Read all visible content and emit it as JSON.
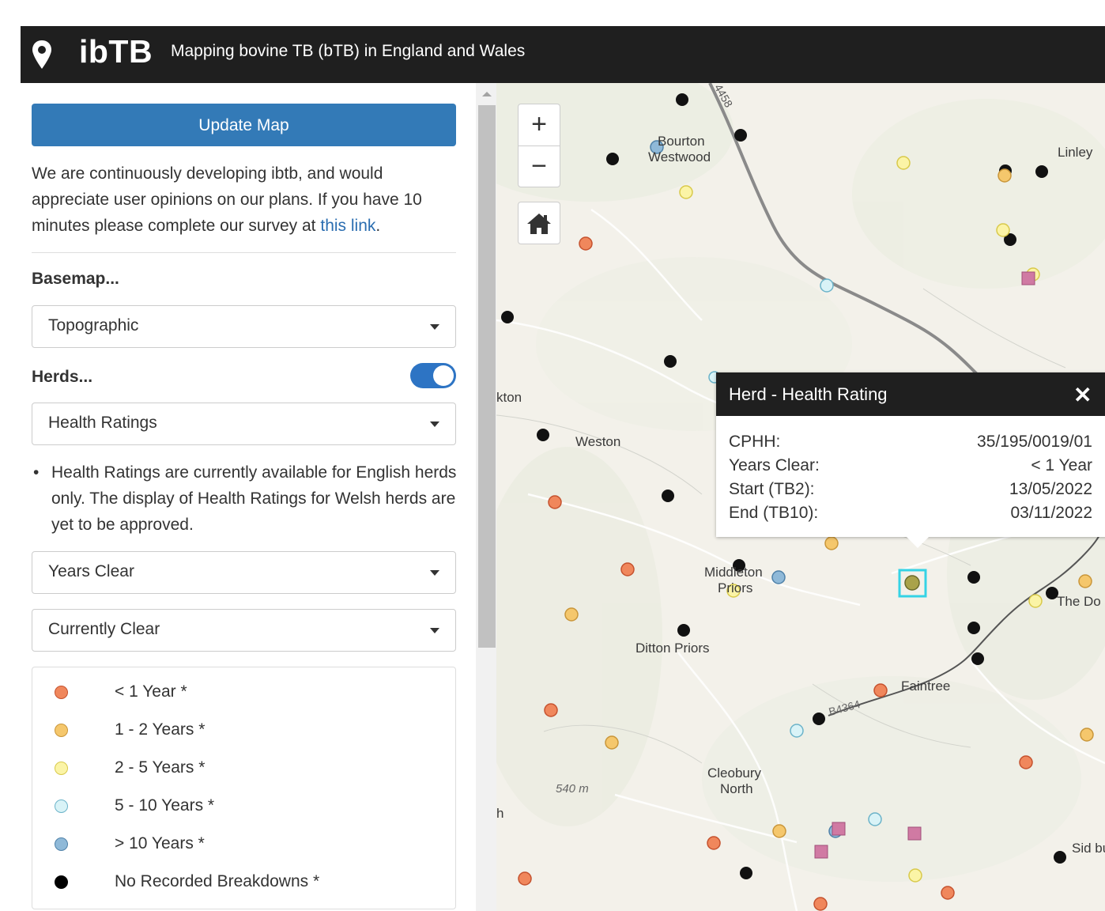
{
  "header": {
    "logo": "ibTB",
    "subtitle": "Mapping bovine TB (bTB) in England and Wales"
  },
  "sidebar": {
    "update_button": "Update Map",
    "intro_text": "We are continuously developing ibtb, and would appreciate user opinions on our plans. If you have 10 minutes please complete our survey at ",
    "intro_link": "this link",
    "intro_end": ".",
    "basemap_label": "Basemap...",
    "basemap_value": "Topographic",
    "herds_label": "Herds...",
    "herds_toggle_on": true,
    "herds_value": "Health Ratings",
    "note_bullet": "•",
    "note_text": "Health Ratings are currently available for English herds only. The display of Health Ratings for Welsh herds are yet to be approved.",
    "years_clear_value": "Years Clear",
    "currently_clear_value": "Currently Clear",
    "legend": [
      {
        "label": "< 1 Year *",
        "color": "#f0875c"
      },
      {
        "label": "1 - 2 Years *",
        "color": "#f5c76c"
      },
      {
        "label": "2 - 5 Years *",
        "color": "#fbf4a6"
      },
      {
        "label": "5 - 10 Years *",
        "color": "#d9f3f7"
      },
      {
        "label": "> 10 Years *",
        "color": "#8fb9d8"
      },
      {
        "label": "No Recorded Breakdowns *",
        "color": "#000000"
      }
    ]
  },
  "map": {
    "zoom_in": "+",
    "zoom_out": "−",
    "home_icon": "home-icon",
    "labels": {
      "bourton": "Bourton",
      "westwood": "Westwood",
      "linley": "Linley",
      "kton": "kton",
      "weston": "Weston",
      "middleton": "Middleton",
      "priors": "Priors",
      "ditton": "Ditton Priors",
      "faintree": "Faintree",
      "b4364": "B4364",
      "cleobury": "Cleobury",
      "north": "North",
      "elev": "540 m",
      "thedo": "The Do",
      "sidb": "Sid bu",
      "road458": "4458",
      "h": "h"
    },
    "popup": {
      "title": "Herd - Health Rating",
      "close": "✕",
      "rows": [
        {
          "key": "CPHH:",
          "value": "35/195/0019/01"
        },
        {
          "key": "Years Clear:",
          "value": "< 1 Year"
        },
        {
          "key": "Start (TB2):",
          "value": "13/05/2022"
        },
        {
          "key": "End (TB10):",
          "value": "03/11/2022"
        }
      ]
    }
  }
}
